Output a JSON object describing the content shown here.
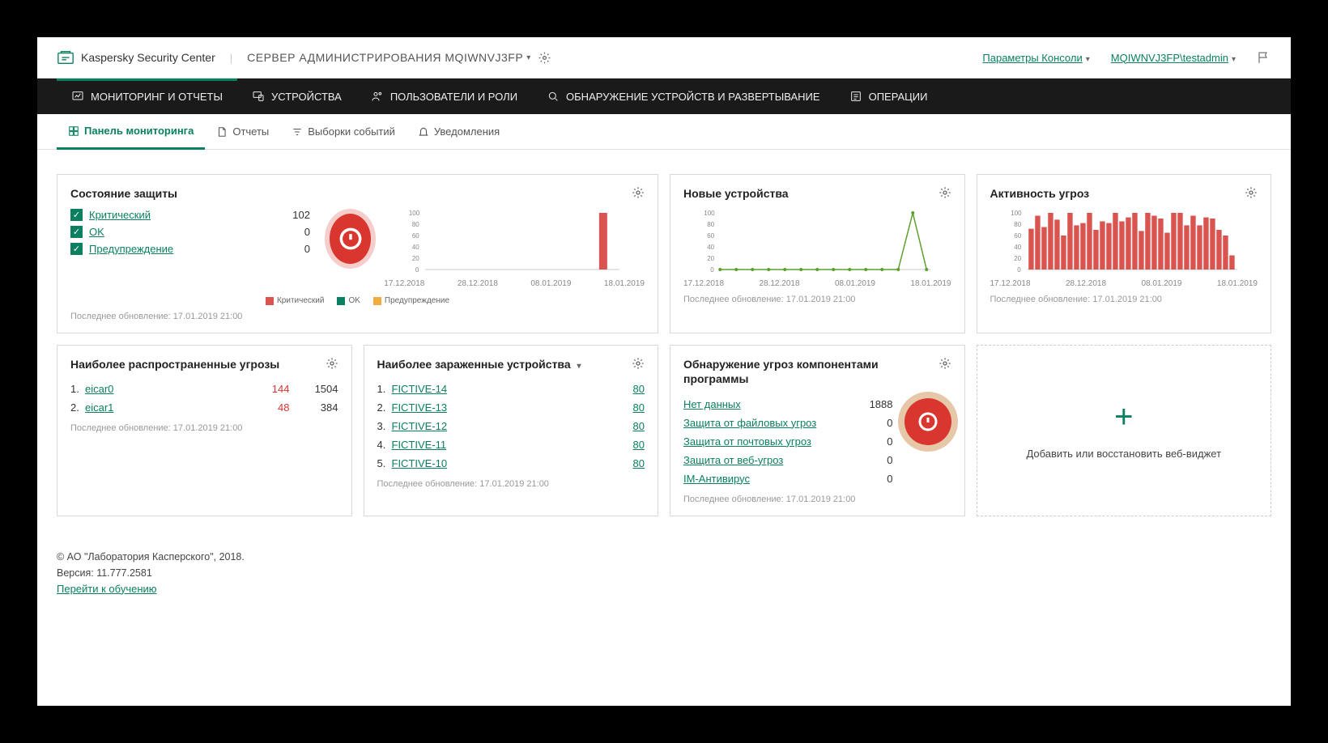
{
  "header": {
    "product": "Kaspersky Security Center",
    "server_label": "СЕРВЕР АДМИНИСТРИРОВАНИЯ MQIWNVJ3FP",
    "console_params": "Параметры Консоли",
    "user": "MQIWNVJ3FP\\testadmin"
  },
  "mainnav": {
    "monitoring": "МОНИТОРИНГ И ОТЧЕТЫ",
    "devices": "УСТРОЙСТВА",
    "users": "ПОЛЬЗОВАТЕЛИ И РОЛИ",
    "discovery": "ОБНАРУЖЕНИЕ УСТРОЙСТВ И РАЗВЕРТЫВАНИЕ",
    "operations": "ОПЕРАЦИИ"
  },
  "subnav": {
    "dashboard": "Панель мониторинга",
    "reports": "Отчеты",
    "events": "Выборки событий",
    "notifications": "Уведомления"
  },
  "w_protection": {
    "title": "Состояние защиты",
    "critical_label": "Критический",
    "critical_value": "102",
    "ok_label": "OK",
    "ok_value": "0",
    "warn_label": "Предупреждение",
    "warn_value": "0",
    "last": "Последнее обновление: 17.01.2019 21:00",
    "legend_critical": "Критический",
    "legend_ok": "OK",
    "legend_warn": "Предупреждение"
  },
  "w_newdev": {
    "title": "Новые устройства",
    "last": "Последнее обновление: 17.01.2019 21:00"
  },
  "w_threat_act": {
    "title": "Активность угроз",
    "last": "Последнее обновление: 17.01.2019 21:00"
  },
  "w_top_threats": {
    "title": "Наиболее распространенные угрозы",
    "rows": [
      {
        "idx": "1.",
        "name": "eicar0",
        "v1": "144",
        "v2": "1504"
      },
      {
        "idx": "2.",
        "name": "eicar1",
        "v1": "48",
        "v2": "384"
      }
    ],
    "last": "Последнее обновление: 17.01.2019 21:00"
  },
  "w_infected": {
    "title": "Наиболее зараженные устройства",
    "rows": [
      {
        "idx": "1.",
        "name": "FICTIVE-14",
        "v": "80"
      },
      {
        "idx": "2.",
        "name": "FICTIVE-13",
        "v": "80"
      },
      {
        "idx": "3.",
        "name": "FICTIVE-12",
        "v": "80"
      },
      {
        "idx": "4.",
        "name": "FICTIVE-11",
        "v": "80"
      },
      {
        "idx": "5.",
        "name": "FICTIVE-10",
        "v": "80"
      }
    ],
    "last": "Последнее обновление: 17.01.2019 21:00"
  },
  "w_detection": {
    "title": "Обнаружение угроз компонентами программы",
    "rows": [
      {
        "name": "Нет данных",
        "v": "1888"
      },
      {
        "name": "Защита от файловых угроз",
        "v": "0"
      },
      {
        "name": "Защита от почтовых угроз",
        "v": "0"
      },
      {
        "name": "Защита от веб-угроз",
        "v": "0"
      },
      {
        "name": "IM-Антивирус",
        "v": "0"
      }
    ],
    "last": "Последнее обновление: 17.01.2019 21:00"
  },
  "w_add": {
    "label": "Добавить или восстановить веб-виджет"
  },
  "footer": {
    "copyright": "© АО \"Лаборатория Касперского\", 2018.",
    "version": "Версия: 11.777.2581",
    "training": "Перейти к обучению"
  },
  "axis_dates": [
    "17.12.2018",
    "28.12.2018",
    "08.01.2019",
    "18.01.2019"
  ],
  "chart_data": [
    {
      "widget": "protection_status",
      "type": "bar",
      "xlabel": "",
      "ylabel": "",
      "ylim": [
        0,
        100
      ],
      "yticks": [
        0,
        20,
        40,
        60,
        80,
        100
      ],
      "categories_range": [
        "17.12.2018",
        "18.01.2019"
      ],
      "series": [
        {
          "name": "Критический",
          "color": "#d9534f",
          "values_nonzero": [
            {
              "date": "17.01.2019",
              "value": 102
            }
          ]
        },
        {
          "name": "OK",
          "color": "#0a8060",
          "values_nonzero": []
        },
        {
          "name": "Предупреждение",
          "color": "#f0ad3e",
          "values_nonzero": []
        }
      ]
    },
    {
      "widget": "new_devices",
      "type": "line",
      "xlabel": "",
      "ylabel": "",
      "ylim": [
        0,
        100
      ],
      "yticks": [
        0,
        20,
        40,
        60,
        80,
        100
      ],
      "categories_range": [
        "17.12.2018",
        "18.01.2019"
      ],
      "series": [
        {
          "name": "Новые устройства",
          "color": "#5aa02c",
          "values_nonzero": [
            {
              "date": "17.01.2019",
              "value": 102
            }
          ]
        }
      ]
    },
    {
      "widget": "threat_activity",
      "type": "bar",
      "xlabel": "",
      "ylabel": "",
      "ylim": [
        0,
        100
      ],
      "yticks": [
        0,
        20,
        40,
        60,
        80,
        100
      ],
      "categories_range": [
        "17.12.2018",
        "18.01.2019"
      ],
      "series": [
        {
          "name": "Активность угроз",
          "color": "#d9534f",
          "approx_values": [
            72,
            95,
            75,
            100,
            88,
            60,
            100,
            78,
            82,
            100,
            70,
            85,
            82,
            100,
            85,
            92,
            100,
            68,
            100,
            95,
            90,
            65,
            100,
            100,
            78,
            95,
            78,
            92,
            90,
            70,
            60,
            25
          ]
        }
      ]
    }
  ]
}
